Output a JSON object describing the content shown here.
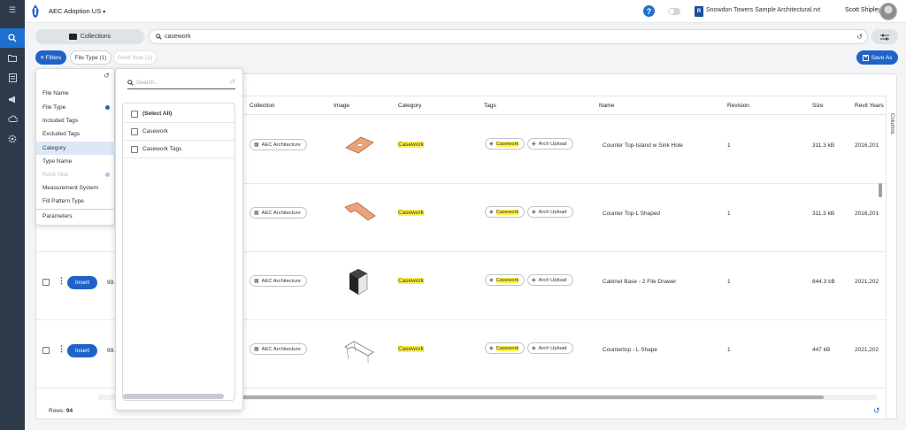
{
  "header": {
    "project_name": "AEC Adoption US",
    "project_caret": "▾",
    "help_label": "?",
    "model_badge": "R",
    "model_name": "Snowdon Towers Sample Architectural.rvt",
    "user_name": "Scott Shipley"
  },
  "rail": {
    "items": [
      {
        "icon": "menu-icon"
      },
      {
        "icon": "search-icon",
        "active": true
      },
      {
        "icon": "folder-icon"
      },
      {
        "icon": "document-icon"
      },
      {
        "icon": "megaphone-icon"
      },
      {
        "icon": "cloud-icon"
      },
      {
        "icon": "settings-icon"
      }
    ]
  },
  "search": {
    "collections_label": "Collections",
    "query": "casework"
  },
  "filter_bar": {
    "filters_label": "Filters",
    "chips": [
      {
        "label": "File Type (1)",
        "faded": false
      },
      {
        "label": "Revit Year (1)",
        "faded": true
      }
    ],
    "save_label": "Save As"
  },
  "filter_menu": {
    "items": [
      {
        "label": "File Name",
        "selected": false,
        "dot": false,
        "faded": false
      },
      {
        "label": "File Type",
        "selected": false,
        "dot": true,
        "faded": false
      },
      {
        "label": "Included Tags",
        "selected": false,
        "dot": false,
        "faded": false
      },
      {
        "label": "Excluded Tags",
        "selected": false,
        "dot": false,
        "faded": false
      },
      {
        "label": "Category",
        "selected": true,
        "dot": false,
        "faded": false
      },
      {
        "label": "Type Name",
        "selected": false,
        "dot": false,
        "faded": false
      },
      {
        "label": "Revit Year",
        "selected": false,
        "dot": true,
        "faded": true
      },
      {
        "label": "Measurement System",
        "selected": false,
        "dot": false,
        "faded": false
      },
      {
        "label": "Fill Pattern Type",
        "selected": false,
        "dot": false,
        "faded": false
      },
      {
        "label": "Parameters",
        "selected": false,
        "dot": false,
        "faded": false
      }
    ]
  },
  "picker": {
    "search_placeholder": "Search...",
    "items": [
      {
        "label": "(Select All)",
        "bold": true
      },
      {
        "label": "Casework",
        "bold": false
      },
      {
        "label": "Casework Tags",
        "bold": false
      }
    ]
  },
  "table": {
    "columns": [
      "Collection",
      "Image",
      "Category",
      "Tags",
      "Name",
      "Revision",
      "Size",
      "Revit Years"
    ],
    "columns_tab": "Columns",
    "insert_label": "Insert",
    "rows": [
      {
        "id": "",
        "collection": "AEC Architecture",
        "category": "Casework",
        "tags": [
          "Casework",
          "Arch Upload"
        ],
        "name": "Counter Top-Island w Sink Hole",
        "revision": "1",
        "size": "311.3 kB",
        "years": "2016,201",
        "thumb": "island",
        "show_actions": false
      },
      {
        "id": "",
        "collection": "AEC Architecture",
        "category": "Casework",
        "tags": [
          "Casework",
          "Arch Upload"
        ],
        "name": "Counter Top-L Shaped",
        "revision": "1",
        "size": "311.3 kB",
        "years": "2016,201",
        "thumb": "lshape",
        "show_actions": false
      },
      {
        "id": "99.",
        "collection": "AEC Architecture",
        "category": "Casework",
        "tags": [
          "Casework",
          "Arch Upload"
        ],
        "name": "Cabinet Base - 2 File Drawer",
        "revision": "1",
        "size": "844.3 kB",
        "years": "2021,202",
        "thumb": "cabinet",
        "show_actions": true
      },
      {
        "id": "99.",
        "collection": "AEC Architecture",
        "category": "Casework",
        "tags": [
          "Casework",
          "Arch Upload"
        ],
        "name": "Countertop - L Shape",
        "revision": "1",
        "size": "447 kB",
        "years": "2021,202",
        "thumb": "wire",
        "show_actions": true
      }
    ],
    "rows_label": "Rows:",
    "rows_count": "94"
  },
  "colors": {
    "accent": "#1f63c9",
    "rail": "#2c3a4a",
    "highlight": "#fff24a"
  }
}
